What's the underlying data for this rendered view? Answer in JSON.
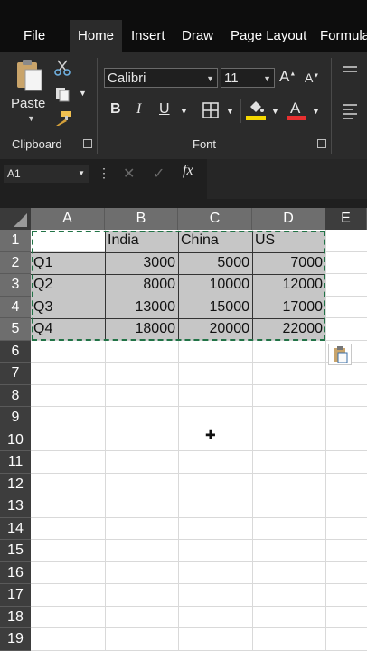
{
  "menu": {
    "tabs": [
      "File",
      "Home",
      "Insert",
      "Draw",
      "Page Layout",
      "Formula"
    ]
  },
  "ribbon": {
    "clipboard": {
      "paste_label": "Paste",
      "group_label": "Clipboard"
    },
    "font": {
      "name": "Calibri",
      "size": "11",
      "group_label": "Font",
      "grow": "A",
      "shrink": "A",
      "bold": "B",
      "italic": "I",
      "underline": "U",
      "fill_color": "#f5d800",
      "font_color": "#e83030"
    }
  },
  "formula_bar": {
    "name_box": "A1",
    "fx": "fx"
  },
  "sheet": {
    "columns": [
      "A",
      "B",
      "C",
      "D",
      "E"
    ],
    "rows": [
      "1",
      "2",
      "3",
      "4",
      "5",
      "6",
      "7",
      "8",
      "9",
      "10",
      "11",
      "12",
      "13",
      "14",
      "15",
      "16",
      "17",
      "18",
      "19"
    ],
    "table": [
      [
        "",
        "India",
        "China",
        "US"
      ],
      [
        "Q1",
        "3000",
        "5000",
        "7000"
      ],
      [
        "Q2",
        "8000",
        "10000",
        "12000"
      ],
      [
        "Q3",
        "13000",
        "15000",
        "17000"
      ],
      [
        "Q4",
        "18000",
        "20000",
        "22000"
      ]
    ]
  },
  "colors": {
    "selection_fill": "#c6c6c6",
    "copy_border": "#217346",
    "header_bg": "#3d3d3d",
    "header_selected": "#6e6e6e"
  }
}
